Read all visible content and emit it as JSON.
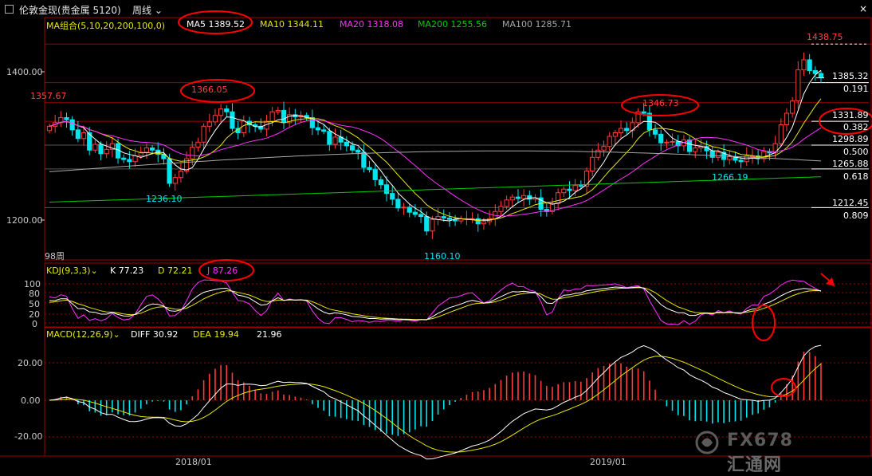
{
  "window": {
    "title": "伦敦金现(贵金属 5120)",
    "period": "周线",
    "close": "×"
  },
  "colors": {
    "up": "#ff3c3c",
    "down": "#00e5ee",
    "ma5": "#ffffff",
    "ma10": "#e8e800",
    "ma20": "#ff30ff",
    "ma200": "#00cc00",
    "ma100": "#a8a8a8",
    "grid": "#a00000",
    "panel_border": "#a00000",
    "fib_label": "#ffffff",
    "highlight_circle": "#ff0000"
  },
  "ma_legend": {
    "group": "MA组合(5,10,20,200,100,0)",
    "ma5": "MA5 1389.52",
    "ma10": "MA10 1344.11",
    "ma20": "MA20 1318.08",
    "ma200": "MA200 1255.56",
    "ma100": "MA100 1285.71"
  },
  "kdj_legend": {
    "group": "KDJ(9,3,3)",
    "k": "K 77.23",
    "d": "D 72.21",
    "j": "J 87.26"
  },
  "macd_legend": {
    "group": "MACD(12,26,9)",
    "diff": "DIFF 30.92",
    "dea": "DEA 19.94",
    "macd": "21.96"
  },
  "price_axis": {
    "ticks": [
      "1400.00",
      "1200.00"
    ],
    "range": [
      1140,
      1460
    ]
  },
  "kdj_axis": {
    "ticks": [
      "100",
      "80",
      "50",
      "20",
      "0"
    ]
  },
  "macd_axis": {
    "ticks": [
      "20.00",
      "0.00",
      "-20.00"
    ]
  },
  "time_axis": {
    "labels": [
      "2018/01",
      "2019/01"
    ]
  },
  "annotations": {
    "high_left": "1366.05",
    "high_mid": "1346.73",
    "high_right": "1438.75",
    "low_left": "1236.10",
    "low_mid": "1160.10",
    "low_right": "1266.19",
    "edge_left": "1357.67",
    "bars_count": "98周"
  },
  "fib_levels": [
    {
      "price": "1385.32",
      "ratio": "0.191",
      "value": 1385.32
    },
    {
      "price": "1331.89",
      "ratio": "0.382",
      "value": 1331.89
    },
    {
      "price": "1298.89",
      "ratio": "0.500",
      "value": 1298.89
    },
    {
      "price": "1265.88",
      "ratio": "0.618",
      "value": 1265.88
    },
    {
      "price": "1212.45",
      "ratio": "0.809",
      "value": 1212.45
    }
  ],
  "watermark": {
    "brand": "FX678",
    "brand_zh": "汇通网"
  },
  "chart_data": {
    "type": "candlestick",
    "series_ma5": "MA5",
    "closes": [
      1325,
      1330,
      1337,
      1334,
      1320,
      1308,
      1316,
      1292,
      1300,
      1287,
      1293,
      1301,
      1281,
      1279,
      1276,
      1284,
      1289,
      1295,
      1292,
      1286,
      1280,
      1246,
      1254,
      1263,
      1280,
      1296,
      1303,
      1325,
      1331,
      1340,
      1349,
      1345,
      1322,
      1316,
      1332,
      1327,
      1325,
      1321,
      1332,
      1345,
      1347,
      1330,
      1341,
      1338,
      1340,
      1337,
      1323,
      1320,
      1318,
      1300,
      1310,
      1303,
      1298,
      1292,
      1289,
      1268,
      1265,
      1251,
      1244,
      1232,
      1224,
      1212,
      1213,
      1206,
      1203,
      1200,
      1180,
      1196,
      1200,
      1198,
      1196,
      1194,
      1197,
      1197,
      1197,
      1190,
      1193,
      1197,
      1207,
      1214,
      1223,
      1227,
      1225,
      1229,
      1224,
      1226,
      1210,
      1207,
      1218,
      1233,
      1238,
      1236,
      1243,
      1242,
      1263,
      1282,
      1292,
      1297,
      1311,
      1316,
      1322,
      1319,
      1330,
      1345,
      1343,
      1320,
      1314,
      1302,
      1303,
      1304,
      1298,
      1306,
      1290,
      1295,
      1297,
      1291,
      1282,
      1289,
      1279,
      1283,
      1278,
      1276,
      1284,
      1284,
      1280,
      1290,
      1288,
      1301,
      1327,
      1343,
      1360,
      1403,
      1417,
      1402,
      1398,
      1392
    ],
    "note": "Weekly London Gold, MA overlays, KDJ and MACD sub-panels"
  }
}
